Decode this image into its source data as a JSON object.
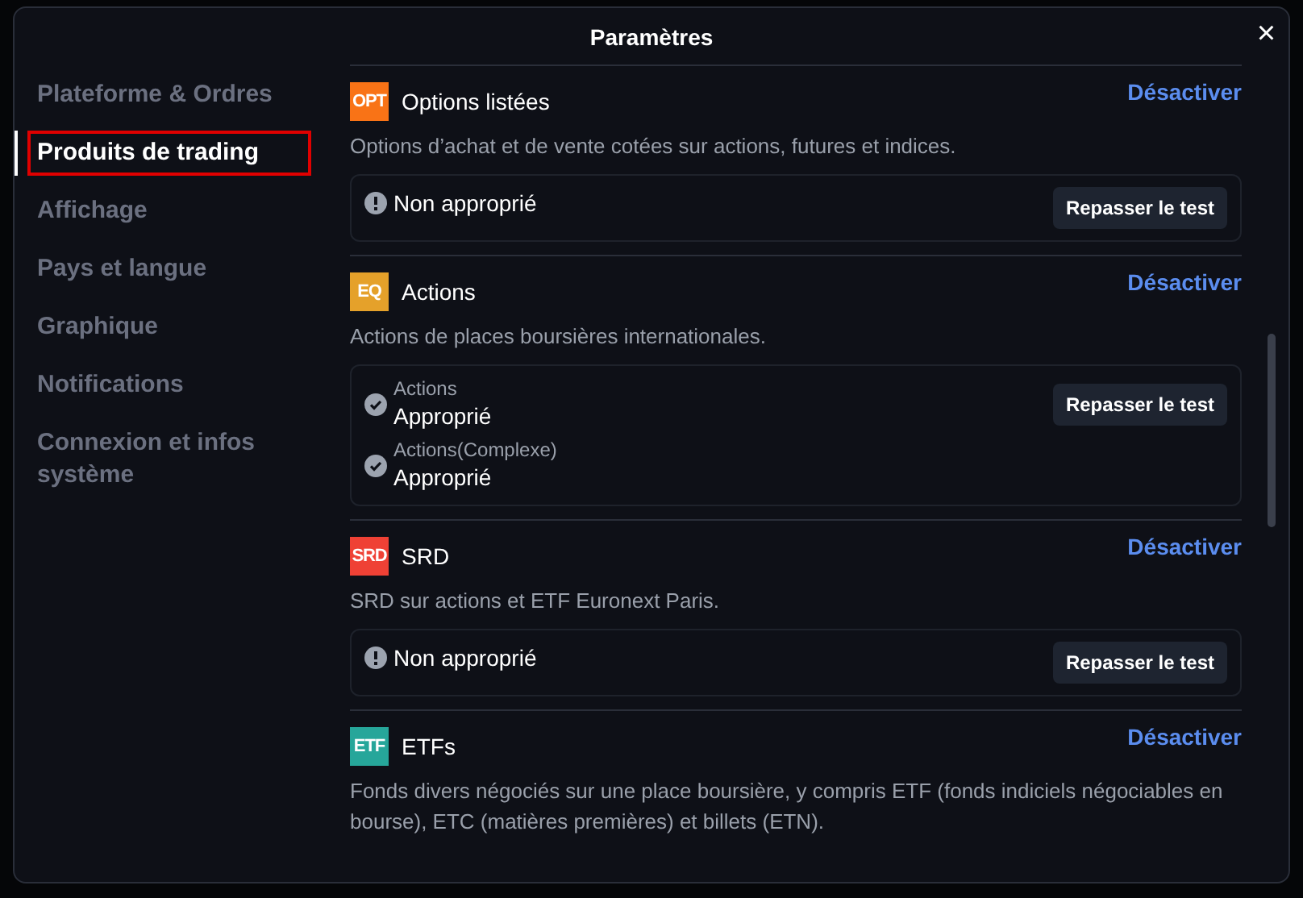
{
  "window": {
    "title": "Paramètres",
    "close": "×"
  },
  "sidebar": {
    "items": [
      {
        "label": "Plateforme & Ordres",
        "selected": false
      },
      {
        "label": "Produits de trading",
        "selected": true
      },
      {
        "label": "Affichage",
        "selected": false
      },
      {
        "label": "Pays et langue",
        "selected": false
      },
      {
        "label": "Graphique",
        "selected": false
      },
      {
        "label": "Notifications",
        "selected": false
      },
      {
        "label": "Connexion et infos système",
        "selected": false
      }
    ]
  },
  "products": [
    {
      "code": "OPT",
      "color": "#f97316",
      "name": "Options listées",
      "action": "Désactiver",
      "description": "Options d’achat et de vente cotées sur actions, futures et indices.",
      "retest": "Repasser le test",
      "results": [
        {
          "kind": "warning",
          "text": "Non approprié"
        }
      ]
    },
    {
      "code": "EQ",
      "color": "#e5a12a",
      "name": "Actions",
      "action": "Désactiver",
      "description": "Actions de places boursières internationales.",
      "retest": "Repasser le test",
      "results": [
        {
          "kind": "ok",
          "category": "Actions",
          "text": "Approprié"
        },
        {
          "kind": "ok",
          "category": "Actions(Complexe)",
          "text": "Approprié"
        }
      ]
    },
    {
      "code": "SRD",
      "color": "#ef4135",
      "name": "SRD",
      "action": "Désactiver",
      "description": "SRD sur actions et ETF Euronext Paris.",
      "retest": "Repasser le test",
      "results": [
        {
          "kind": "warning",
          "text": "Non approprié"
        }
      ]
    },
    {
      "code": "ETF",
      "color": "#26a69a",
      "name": "ETFs",
      "action": "Désactiver",
      "description": "Fonds divers négociés sur une place boursière, y compris ETF (fonds indiciels négociables en bourse), ETC (matières premières) et billets (ETN)."
    }
  ]
}
